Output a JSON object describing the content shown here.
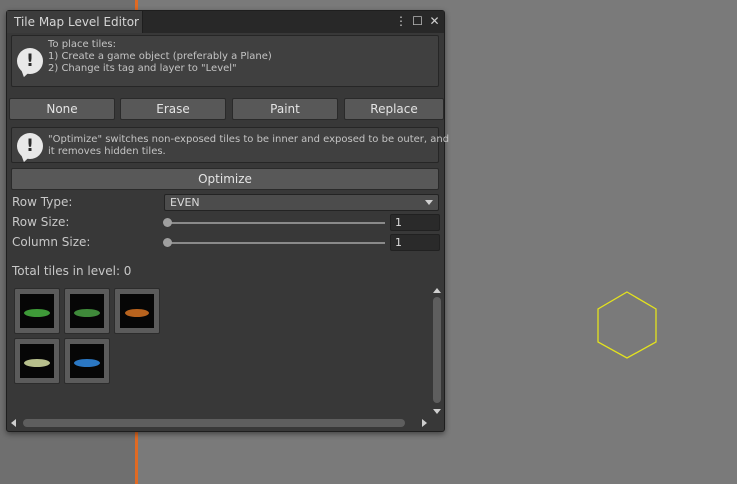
{
  "window": {
    "title": "Tile Map Level Editor",
    "icons": [
      "more-vertical-icon",
      "maximize-icon",
      "close-icon"
    ]
  },
  "help_place": {
    "text": "To place tiles:\n1) Create a game object (preferably a Plane)\n2) Change its tag and layer to \"Level\""
  },
  "tools": {
    "buttons": [
      {
        "label": "None"
      },
      {
        "label": "Erase"
      },
      {
        "label": "Paint"
      },
      {
        "label": "Replace"
      }
    ]
  },
  "help_optimize": {
    "text": "\"Optimize\" switches non-exposed tiles to be inner and exposed to be outer, and\nit removes hidden tiles."
  },
  "optimize": {
    "label": "Optimize"
  },
  "settings": {
    "row_type": {
      "label": "Row Type:",
      "value": "EVEN"
    },
    "row_size": {
      "label": "Row Size:",
      "value": "1"
    },
    "column_size": {
      "label": "Column Size:",
      "value": "1"
    }
  },
  "total_tiles": {
    "text": "Total tiles in level: 0"
  },
  "palette": {
    "tiles": [
      {
        "name": "green-tile",
        "color": "#3e9a38",
        "selected": true
      },
      {
        "name": "green-tile-dark",
        "color": "#3f8a3a",
        "selected": false
      },
      {
        "name": "orange-tile",
        "color": "#b8631e",
        "selected": false
      },
      {
        "name": "pale-green-tile",
        "color": "#b7bf8c",
        "selected": true
      },
      {
        "name": "blue-tile",
        "color": "#2b78c4",
        "selected": false
      }
    ]
  },
  "colors": {
    "accent_orange": "#e06a23",
    "hex_outline": "#e3e21e"
  }
}
